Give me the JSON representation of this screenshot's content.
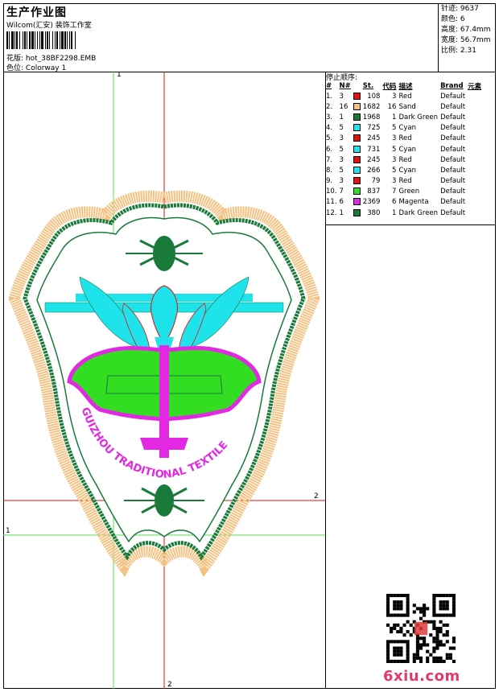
{
  "header": {
    "title": "生产作业图",
    "studio": "Wilcom(汇安) 装饰工作室",
    "filename_label": "花版:",
    "filename": "hot_38BF2298.EMB",
    "colorway_label": "色位:",
    "colorway": "Colorway 1"
  },
  "stats": {
    "stitches": "针迹: 9637",
    "colors": "颜色: 6",
    "height": "高度: 67.4mm",
    "width": "宽度: 56.7mm",
    "scale": "比例: 2.31"
  },
  "stops": {
    "title": "停止顺序:",
    "headers": [
      "#",
      "N#",
      "St.",
      "代码",
      "描述",
      "Brand",
      "元素"
    ],
    "rows": [
      {
        "idx": "1.",
        "n": "3",
        "color": "#e41010",
        "st": "108",
        "code": "3",
        "desc": "Red",
        "brand": "Default"
      },
      {
        "idx": "2.",
        "n": "16",
        "color": "#f6c283",
        "st": "1682",
        "code": "16",
        "desc": "Sand",
        "brand": "Default"
      },
      {
        "idx": "3.",
        "n": "1",
        "color": "#1a7a3a",
        "st": "1968",
        "code": "1",
        "desc": "Dark Green",
        "brand": "Default"
      },
      {
        "idx": "4.",
        "n": "5",
        "color": "#1fe3ea",
        "st": "725",
        "code": "5",
        "desc": "Cyan",
        "brand": "Default"
      },
      {
        "idx": "5.",
        "n": "3",
        "color": "#e41010",
        "st": "245",
        "code": "3",
        "desc": "Red",
        "brand": "Default"
      },
      {
        "idx": "6.",
        "n": "5",
        "color": "#1fe3ea",
        "st": "731",
        "code": "5",
        "desc": "Cyan",
        "brand": "Default"
      },
      {
        "idx": "7.",
        "n": "3",
        "color": "#e41010",
        "st": "245",
        "code": "3",
        "desc": "Red",
        "brand": "Default"
      },
      {
        "idx": "8.",
        "n": "5",
        "color": "#1fe3ea",
        "st": "266",
        "code": "5",
        "desc": "Cyan",
        "brand": "Default"
      },
      {
        "idx": "9.",
        "n": "3",
        "color": "#e41010",
        "st": "79",
        "code": "3",
        "desc": "Red",
        "brand": "Default"
      },
      {
        "idx": "10.",
        "n": "7",
        "color": "#33dd22",
        "st": "837",
        "code": "7",
        "desc": "Green",
        "brand": "Default"
      },
      {
        "idx": "11.",
        "n": "6",
        "color": "#e228e2",
        "st": "2369",
        "code": "6",
        "desc": "Magenta",
        "brand": "Default"
      },
      {
        "idx": "12.",
        "n": "1",
        "color": "#1a7a3a",
        "st": "380",
        "code": "1",
        "desc": "Dark Green",
        "brand": "Default"
      }
    ]
  },
  "guides": {
    "v1": "1",
    "v2": "2",
    "h1": "1",
    "h2": "2"
  },
  "design": {
    "badge_text": "GUIZHOU TRADITIONAL TEXTILE"
  },
  "watermark": "6xiu.com",
  "colors": {
    "sand": "#f6c283",
    "dark_green": "#1a7a3a",
    "cyan": "#1fe3ea",
    "red": "#e41010",
    "green": "#33dd22",
    "magenta": "#e228e2"
  }
}
